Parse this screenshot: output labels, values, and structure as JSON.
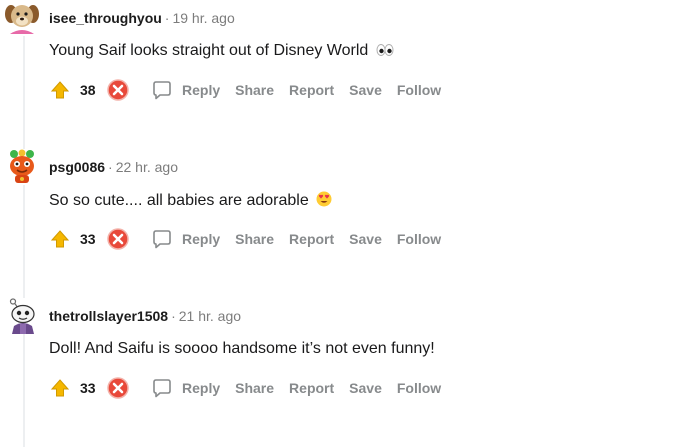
{
  "comments": [
    {
      "username": "isee_throughyou",
      "separator": "·",
      "time": "19 hr. ago",
      "text": "Young Saif looks straight out of Disney World",
      "emoji": "eyes-emoji",
      "score": "38",
      "avatar": "dog-avatar"
    },
    {
      "username": "psg0086",
      "separator": "·",
      "time": "22 hr. ago",
      "text": "So so cute.... all babies are adorable",
      "emoji": "heart-eyes-emoji",
      "score": "33",
      "avatar": "orange-creature-avatar"
    },
    {
      "username": "thetrollslayer1508",
      "separator": "·",
      "time": "21 hr. ago",
      "text": "Doll! And Saifu is soooo handsome it’s not even funny!",
      "emoji": "",
      "score": "33",
      "avatar": "snoo-avatar"
    }
  ],
  "actions": {
    "reply": "Reply",
    "share": "Share",
    "report": "Report",
    "save": "Save",
    "follow": "Follow"
  },
  "colors": {
    "upvote": "#f5b700",
    "downvote": "#e8493a",
    "muted": "#878a8c",
    "thread_line": "#edeff1"
  }
}
